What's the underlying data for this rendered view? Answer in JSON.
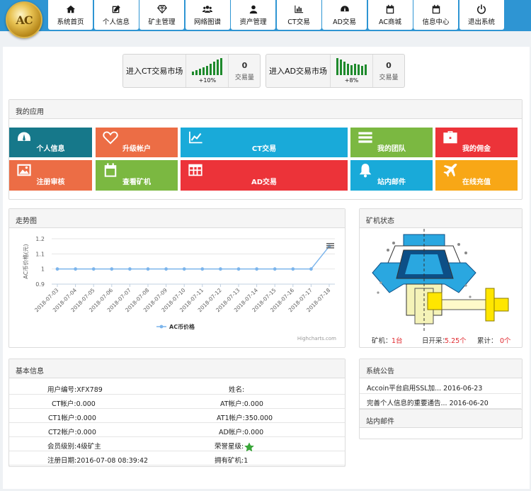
{
  "logo": {
    "text": "AC"
  },
  "nav": [
    {
      "label": "系统首页",
      "icon": "home-icon"
    },
    {
      "label": "个人信息",
      "icon": "edit-icon"
    },
    {
      "label": "矿主管理",
      "icon": "diamond-icon"
    },
    {
      "label": "网络图谱",
      "icon": "users-icon"
    },
    {
      "label": "资产管理",
      "icon": "user-icon"
    },
    {
      "label": "CT交易",
      "icon": "bar-chart-icon"
    },
    {
      "label": "AD交易",
      "icon": "dashboard-icon"
    },
    {
      "label": "AC商城",
      "icon": "calendar-icon"
    },
    {
      "label": "信息中心",
      "icon": "calendar-icon"
    },
    {
      "label": "退出系统",
      "icon": "power-icon"
    }
  ],
  "markets": [
    {
      "title": "进入CT交易市场",
      "pct": "+10%",
      "count": "0",
      "count_label": "交易量",
      "bars": [
        5,
        7,
        9,
        11,
        13,
        16,
        19,
        22,
        24
      ]
    },
    {
      "title": "进入AD交易市场",
      "pct": "+8%",
      "count": "0",
      "count_label": "交易量",
      "bars": [
        22,
        20,
        17,
        15,
        13,
        15,
        14,
        12,
        14
      ]
    }
  ],
  "apps": {
    "title": "我的应用",
    "tiles": [
      {
        "label": "个人信息",
        "color": "#16788a",
        "icon": "dashboard-icon"
      },
      {
        "label": "升级帐户",
        "color": "#ec6d45",
        "icon": "heart-icon"
      },
      {
        "label": "CT交易",
        "color": "#19aad9",
        "icon": "line-chart-icon"
      },
      {
        "label": "我的团队",
        "color": "#7bb841",
        "icon": "list-icon"
      },
      {
        "label": "我的佣金",
        "color": "#ec3339",
        "icon": "briefcase-icon"
      },
      {
        "label": "注册审核",
        "color": "#ec6d45",
        "icon": "picture-icon"
      },
      {
        "label": "查看矿机",
        "color": "#7bb841",
        "icon": "calendar-icon"
      },
      {
        "label": "AD交易",
        "color": "#ec3339",
        "icon": "table-icon"
      },
      {
        "label": "站内邮件",
        "color": "#19aad9",
        "icon": "bell-icon"
      },
      {
        "label": "在线充值",
        "color": "#f8a716",
        "icon": "plane-icon"
      }
    ]
  },
  "trend": {
    "title": "走势图",
    "credit": "Highcharts.com",
    "chart_data": {
      "type": "line",
      "ylabel": "AC币价格(元)",
      "ylim": [
        0.9,
        1.2
      ],
      "yticks": [
        "1.2",
        "1.1",
        "1",
        "0.9"
      ],
      "categories": [
        "2018-07-03",
        "2018-07-04",
        "2018-07-05",
        "2018-07-06",
        "2018-07-07",
        "2018-07-08",
        "2018-07-09",
        "2018-07-10",
        "2018-07-11",
        "2018-07-12",
        "2018-07-13",
        "2018-07-14",
        "2018-07-15",
        "2018-07-16",
        "2018-07-17",
        "2018-07-18"
      ],
      "series": [
        {
          "name": "AC币价格",
          "color": "#7cb5ec",
          "values": [
            1,
            1,
            1,
            1,
            1,
            1,
            1,
            1,
            1,
            1,
            1,
            1,
            1,
            1,
            1,
            1.15
          ]
        }
      ]
    }
  },
  "machine": {
    "title": "矿机状态",
    "l1": "矿机：",
    "v1": "1台",
    "l2": "日开采：",
    "v2": "5.25个",
    "l3": "累计：",
    "v3": "0个",
    "accent": "#e0282e"
  },
  "basic": {
    "title": "基本信息",
    "rows": [
      [
        "用户编号:XFX789",
        "姓名:"
      ],
      [
        "CT帐户:0.000",
        "AT帐户:0.000"
      ],
      [
        "CT1帐户:0.000",
        "AT1帐户:350.000"
      ],
      [
        "CT2帐户:0.000",
        "AD帐户:0.000"
      ],
      [
        "会员级别:4级矿主",
        "荣誉星级:"
      ],
      [
        "注册日期:2016-07-08 08:39:42",
        "拥有矿机:1"
      ]
    ],
    "star_rating": 5,
    "star_color": "#3aa63a"
  },
  "notice": {
    "title": "系统公告",
    "items": [
      "Accoin平台启用SSL加... 2016-06-23",
      "完善个人信息的重要通告... 2016-06-20"
    ],
    "mail_title": "站内邮件"
  }
}
